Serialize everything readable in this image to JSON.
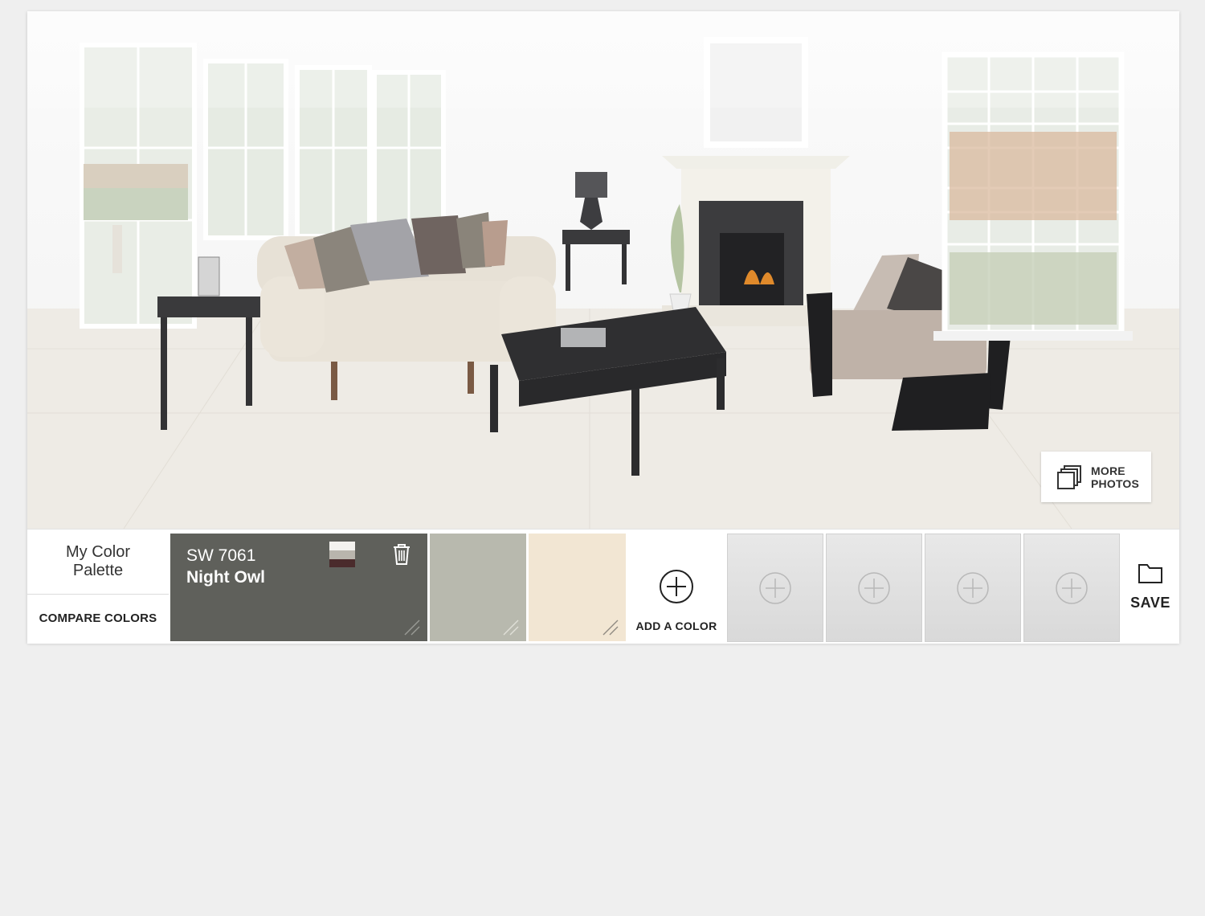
{
  "scene": {
    "more_photos_label_line1": "MORE",
    "more_photos_label_line2": "PHOTOS"
  },
  "palette": {
    "title_line1": "My Color",
    "title_line2": "Palette",
    "compare_label": "COMPARE COLORS",
    "active_swatch": {
      "code": "SW 7061",
      "name": "Night Owl",
      "color": "#5f605b"
    },
    "swatches": [
      {
        "color": "#b8b9ae"
      },
      {
        "color": "#f2e6d3"
      }
    ],
    "add_color_label": "ADD A COLOR",
    "empty_slot_count": 4,
    "save_label": "SAVE"
  },
  "colors": {
    "background": "#efefef",
    "bar_text": "#222222",
    "empty_slot": "#dcdcdc"
  }
}
